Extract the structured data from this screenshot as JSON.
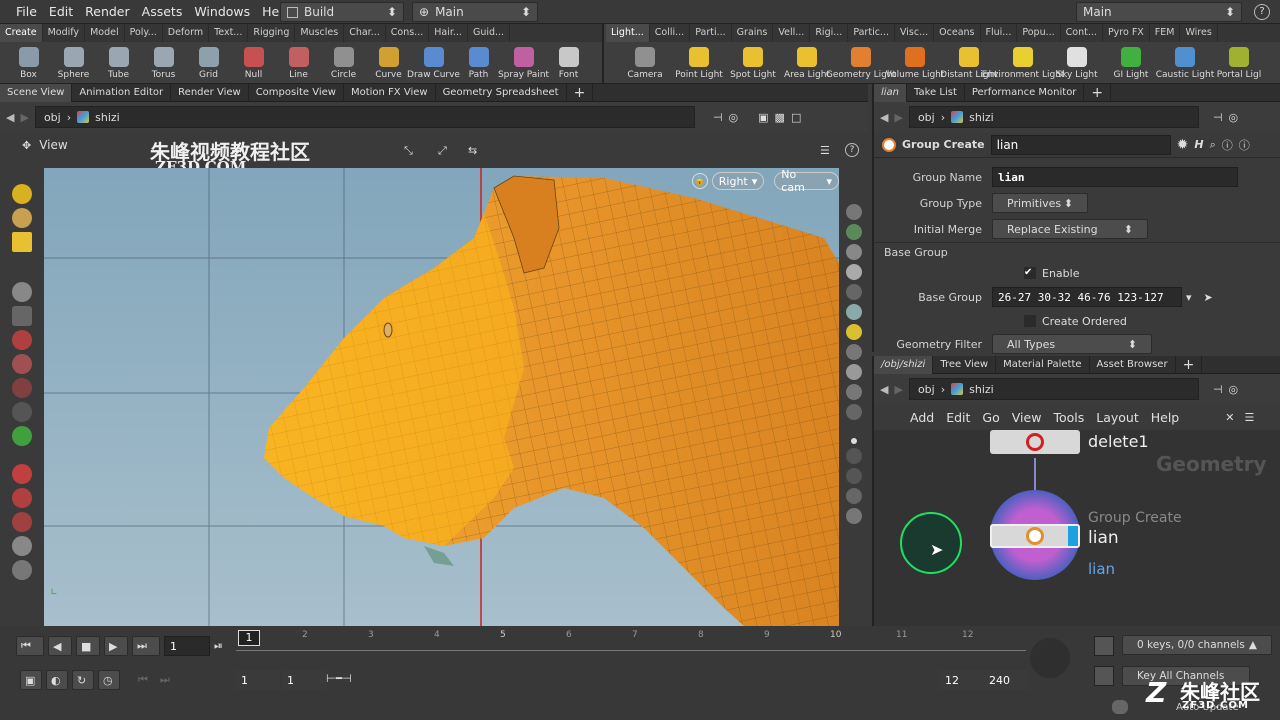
{
  "menubar": {
    "items": [
      "File",
      "Edit",
      "Render",
      "Assets",
      "Windows",
      "Help"
    ],
    "build": "Build",
    "main": "Main",
    "desktop": "Main",
    "help_icon": "question-icon"
  },
  "shelf_left": {
    "tabs": [
      "Create",
      "Modify",
      "Model",
      "Poly...",
      "Deform",
      "Text...",
      "Rigging",
      "Muscles",
      "Char...",
      "Cons...",
      "Hair...",
      "Guid..."
    ],
    "tools": [
      {
        "label": "Box",
        "color": "#8a9aa8"
      },
      {
        "label": "Sphere",
        "color": "#9aa6b2"
      },
      {
        "label": "Tube",
        "color": "#9aa6b2"
      },
      {
        "label": "Torus",
        "color": "#9aa6b2"
      },
      {
        "label": "Grid",
        "color": "#8fa0ad"
      },
      {
        "label": "Null",
        "color": "#c85050"
      },
      {
        "label": "Line",
        "color": "#c06060"
      },
      {
        "label": "Circle",
        "color": "#909090"
      },
      {
        "label": "Curve",
        "color": "#d0a030"
      },
      {
        "label": "Draw Curve",
        "color": "#5a8ad0"
      },
      {
        "label": "Path",
        "color": "#5a8ad0"
      },
      {
        "label": "Spray Paint",
        "color": "#c060a0"
      },
      {
        "label": "Font",
        "color": "#c8c8c8"
      }
    ]
  },
  "shelf_right": {
    "tabs": [
      "Light...",
      "Colli...",
      "Parti...",
      "Grains",
      "Vell...",
      "Rigi...",
      "Partic...",
      "Visc...",
      "Oceans",
      "Flui...",
      "Popu...",
      "Cont...",
      "Pyro FX",
      "FEM",
      "Wires"
    ],
    "tools": [
      {
        "label": "Camera",
        "color": "#909090"
      },
      {
        "label": "Point Light",
        "color": "#e8c030"
      },
      {
        "label": "Spot Light",
        "color": "#e8c030"
      },
      {
        "label": "Area Light",
        "color": "#e8c030"
      },
      {
        "label": "Geometry Light",
        "color": "#e08030"
      },
      {
        "label": "Volume Light",
        "color": "#e07020"
      },
      {
        "label": "Distant Light",
        "color": "#e8c030"
      },
      {
        "label": "Environment Light",
        "color": "#e8d030"
      },
      {
        "label": "Sky Light",
        "color": "#e0e0e0"
      },
      {
        "label": "GI Light",
        "color": "#40b040"
      },
      {
        "label": "Caustic Light",
        "color": "#5090d0"
      },
      {
        "label": "Portal Ligl",
        "color": "#a0b030"
      }
    ]
  },
  "viewer": {
    "tabs": [
      "Scene View",
      "Animation Editor",
      "Render View",
      "Composite View",
      "Motion FX View",
      "Geometry Spreadsheet"
    ],
    "path_obj": "obj",
    "path_node": "shizi",
    "view_label": "View",
    "cam_right": "Right",
    "cam_nocam": "No cam",
    "watermark_cn": "朱峰视频教程社区",
    "watermark_url": "ZF3D.COM"
  },
  "params": {
    "tabs": [
      "lian",
      "Take List",
      "Performance Monitor"
    ],
    "path_obj": "obj",
    "path_node": "shizi",
    "node_type": "Group Create",
    "node_name": "lian",
    "group_name_label": "Group Name",
    "group_name": "lian",
    "group_type_label": "Group Type",
    "group_type": "Primitives",
    "initial_merge_label": "Initial Merge",
    "initial_merge": "Replace Existing",
    "base_group_section": "Base Group",
    "enable_label": "Enable",
    "base_group_label": "Base Group",
    "base_group": "26-27 30-32 46-76 123-127",
    "create_ordered_label": "Create Ordered",
    "geometry_filter_label": "Geometry Filter",
    "geometry_filter": "All Types"
  },
  "network": {
    "tabs": [
      "/obj/shizi",
      "Tree View",
      "Material Palette",
      "Asset Browser"
    ],
    "path_obj": "obj",
    "path_node": "shizi",
    "menus": [
      "Add",
      "Edit",
      "Go",
      "View",
      "Tools",
      "Layout",
      "Help"
    ],
    "context": "Geometry",
    "node1_name": "delete1",
    "node2_type": "Group Create",
    "node2_name": "lian",
    "node2_sub": "lian"
  },
  "timeline": {
    "frame": "1",
    "marks": [
      "1",
      "2",
      "3",
      "4",
      "5",
      "6",
      "7",
      "8",
      "9",
      "10",
      "11",
      "12"
    ],
    "start": "1",
    "start2": "1",
    "end": "12",
    "end2": "240",
    "keys": "0 keys, 0/0 channels",
    "key_all": "Key All Channels",
    "auto_update": "Auto Update"
  },
  "corner_watermark": {
    "cn": "朱峰社区",
    "url": "ZF3D.COM"
  }
}
